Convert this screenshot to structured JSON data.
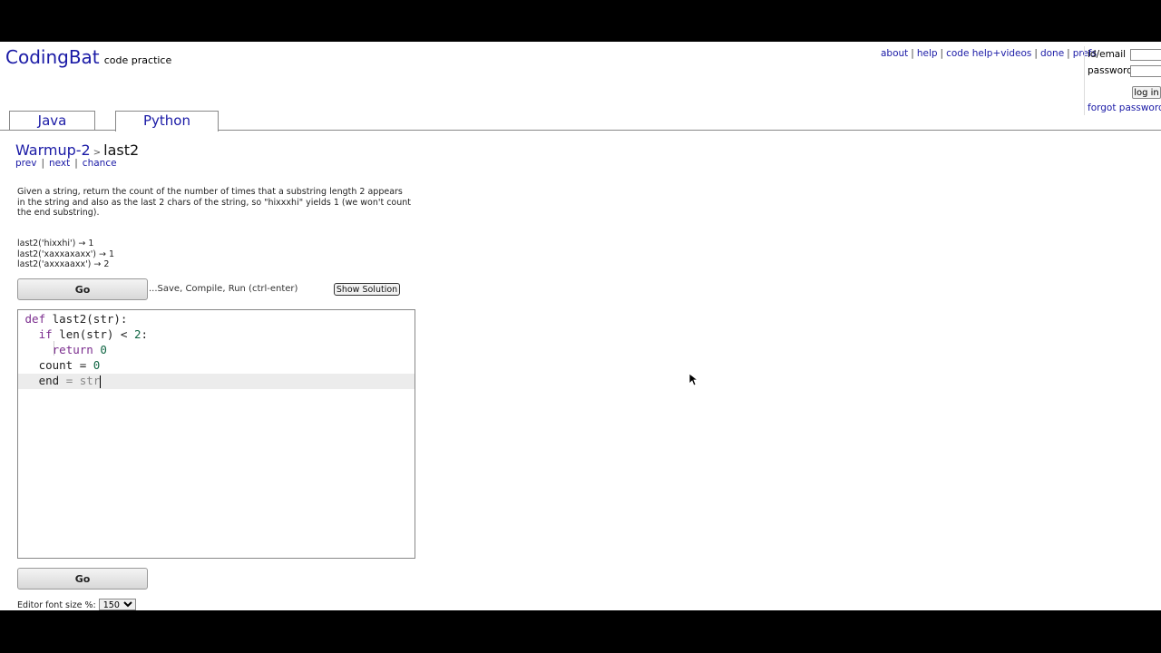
{
  "site": {
    "name": "CodingBat",
    "tagline": "code practice"
  },
  "topnav": [
    "about",
    "help",
    "code help+videos",
    "done",
    "prefs"
  ],
  "login": {
    "id_label": "id/email",
    "password_label": "password",
    "login_button": "log in",
    "forgot": "forgot password"
  },
  "tabs": [
    {
      "label": "Java"
    },
    {
      "label": "Python",
      "selected": true
    }
  ],
  "breadcrumb": {
    "section": "Warmup-2",
    "separator": ">",
    "problem": "last2"
  },
  "subnav": [
    "prev",
    "next",
    "chance"
  ],
  "description": "Given a string, return the count of the number of times that a substring length 2 appears in the string and also as the last 2 chars of the string, so \"hixxxhi\" yields 1 (we won't count the end substring).",
  "examples": [
    "last2('hixxhi') → 1",
    "last2('xaxxaxaxx') → 1",
    "last2('axxxaaxx') → 2"
  ],
  "go_label": "Go",
  "run_hint": "...Save, Compile, Run (ctrl-enter)",
  "show_solution": "Show Solution",
  "editor": {
    "lines": [
      "def last2(str):",
      "  if len(str) < 2:",
      "    return 0",
      "  count = 0",
      "  end = str"
    ],
    "active_line": 5
  },
  "font_size": {
    "label": "Editor font size %:",
    "value": "150"
  },
  "colors": {
    "link": "#1a1aa6",
    "keyword": "#7b2d8e",
    "number": "#116644"
  },
  "icons": {
    "mouse": "mouse-pointer-icon"
  }
}
